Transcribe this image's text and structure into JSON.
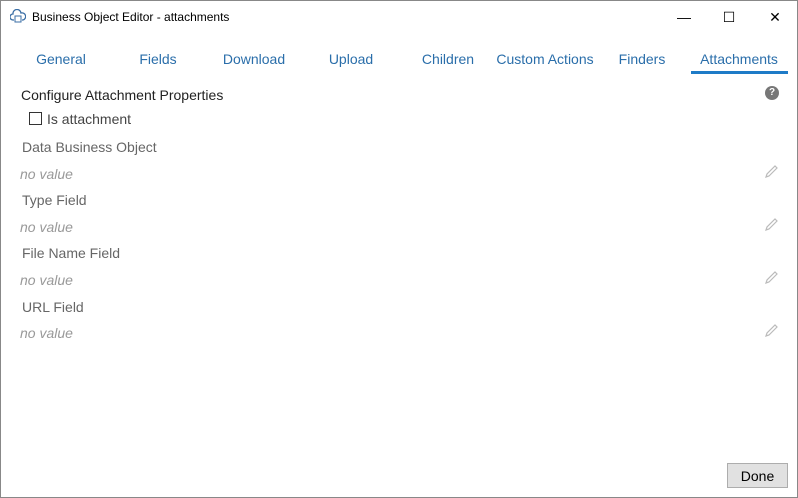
{
  "window": {
    "title": "Business Object Editor - attachments",
    "minimize": "—",
    "maximize": "☐",
    "close": "✕"
  },
  "tabs": [
    {
      "label": "General"
    },
    {
      "label": "Fields"
    },
    {
      "label": "Download"
    },
    {
      "label": "Upload"
    },
    {
      "label": "Children"
    },
    {
      "label": "Custom Actions"
    },
    {
      "label": "Finders"
    },
    {
      "label": "Attachments"
    }
  ],
  "active_tab": "Attachments",
  "section": {
    "title": "Configure Attachment Properties",
    "help": "?"
  },
  "is_attachment": {
    "label": "Is attachment",
    "checked": false
  },
  "fields": [
    {
      "label": "Data Business Object",
      "value": "no value"
    },
    {
      "label": "Type Field",
      "value": "no value"
    },
    {
      "label": "File Name Field",
      "value": "no value"
    },
    {
      "label": "URL Field",
      "value": "no value"
    }
  ],
  "done_label": "Done"
}
